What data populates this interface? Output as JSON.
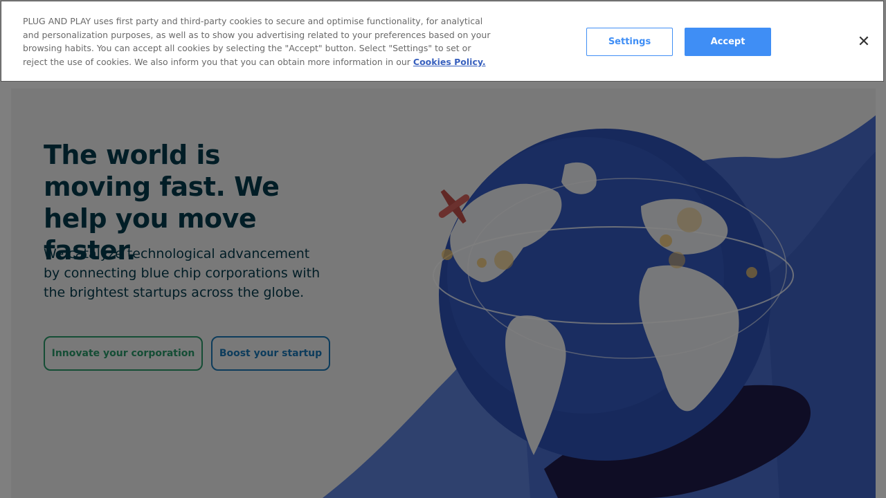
{
  "cookie_banner": {
    "message": "PLUG AND PLAY uses first party and third-party cookies to secure and optimise functionality, for analytical and personalization purposes, as well as to show you advertising related to your preferences based on your browsing habits. You can accept all cookies by selecting the \"Accept\" button. Select \"Settings\" to set or reject the use of cookies. We also inform you that you can obtain more information in our",
    "policy_link": "Cookies Policy.",
    "settings_label": "Settings",
    "accept_label": "Accept",
    "close_icon": "close-icon",
    "close_glyph": "✕",
    "accent_color": "#3f8ef5"
  },
  "hero": {
    "title": "The world is moving fast. We help you move faster.",
    "subtitle": "We catalyze technological advancement by connecting blue chip corporations with the brightest startups across the globe.",
    "buttons": {
      "corporation": "Innovate your corporation",
      "startup": "Boost your startup"
    },
    "colors": {
      "title": "#023a4c",
      "corporation_button": "#2a9a6a",
      "startup_button": "#1a78b8"
    }
  }
}
